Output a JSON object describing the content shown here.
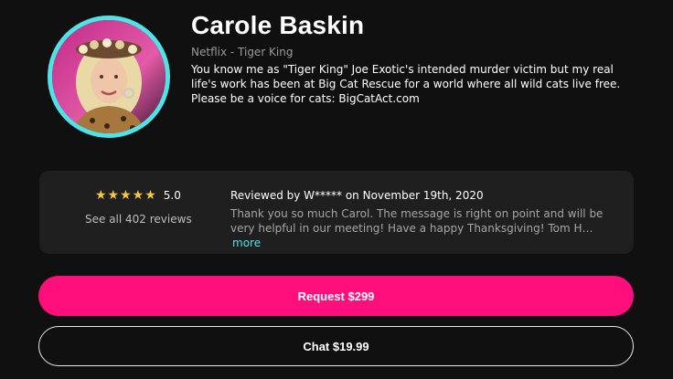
{
  "profile": {
    "name": "Carole Baskin",
    "category": "Netflix - Tiger King",
    "bio": "You know me as \"Tiger King\" Joe Exotic's intended murder victim but my real life's work has been at Big Cat Rescue for a world where all wild cats live free. Please be a voice for cats: BigCatAct.com",
    "avatar_icon": "person-photo",
    "ring_color": "#4fe3e8"
  },
  "reviews": {
    "stars": "★★★★★",
    "rating": "5.0",
    "see_all_label": "See all 402 reviews",
    "latest": {
      "meta": "Reviewed by W***** on November 19th, 2020",
      "text": "Thank you so much Carol. The message is right on point and will be very helpful in our meeting! Have a happy Thanksgiving! Tom H…",
      "more_label": "more"
    },
    "star_color": "#f4c742"
  },
  "actions": {
    "request_label": "Request $299",
    "request_color": "#ff0f7b",
    "chat_label": "Chat $19.99"
  }
}
